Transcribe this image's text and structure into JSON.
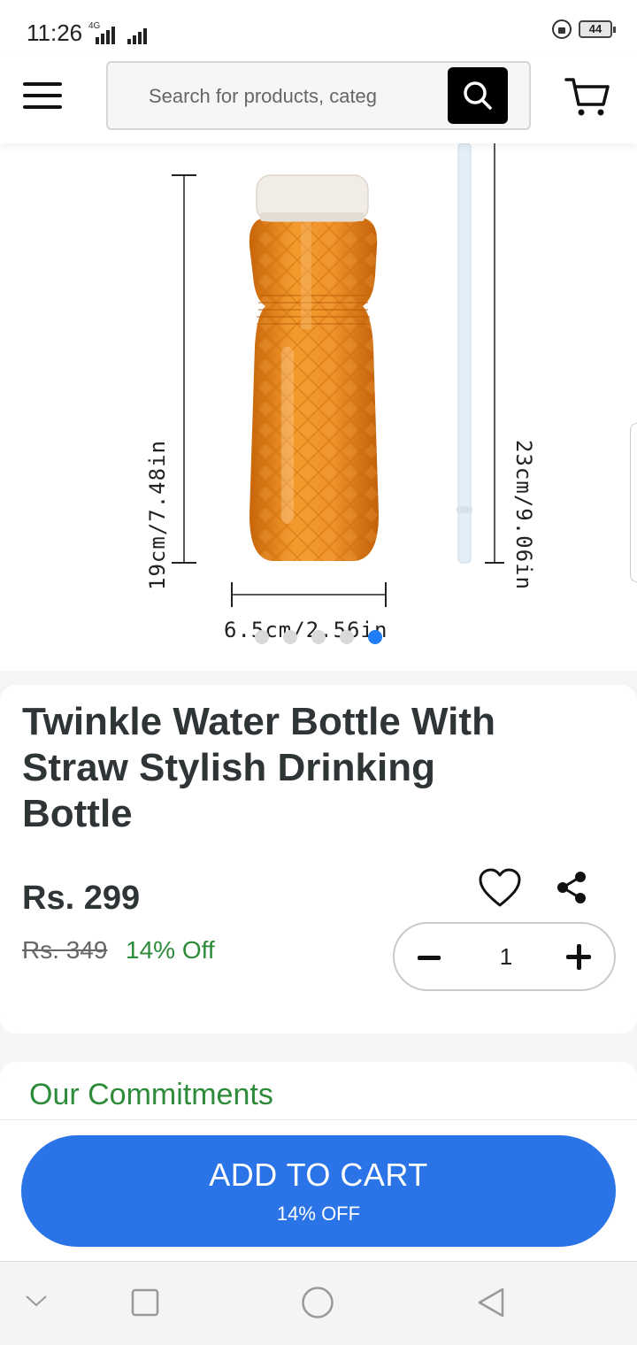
{
  "status_bar": {
    "time": "11:26",
    "network_label": "4G",
    "battery_level": "44"
  },
  "header": {
    "search_placeholder": "Search for products, categ",
    "icons": [
      "menu-icon",
      "search-icon",
      "cart-icon"
    ]
  },
  "gallery": {
    "height_label": "19cm/7.48in",
    "straw_label": "23cm/9.06in",
    "width_label": "6.5cm/2.56in",
    "slide_count": 5,
    "active_slide": 5,
    "colors": {
      "bottle": "#e98a1c",
      "cap": "#f1ece6",
      "active_dot": "#1f7ef4"
    }
  },
  "product": {
    "title": "Twinkle Water Bottle With Straw Stylish Drinking Bottle",
    "price": "Rs. 299",
    "old_price": "Rs. 349",
    "discount": "14% Off",
    "quantity": "1",
    "icons": [
      "heart-icon",
      "share-icon",
      "minus-icon",
      "plus-icon"
    ]
  },
  "commitments": {
    "title": "Our Commitments"
  },
  "action": {
    "label": "ADD TO CART",
    "sublabel": "14% OFF",
    "color": "#2b74e8"
  },
  "colors": {
    "accent_green": "#2e8b3a",
    "text_dark": "#2f3437"
  },
  "nav_bar": {
    "icons": [
      "chevron-down-icon",
      "recents-square-icon",
      "home-circle-icon",
      "back-triangle-icon"
    ]
  }
}
